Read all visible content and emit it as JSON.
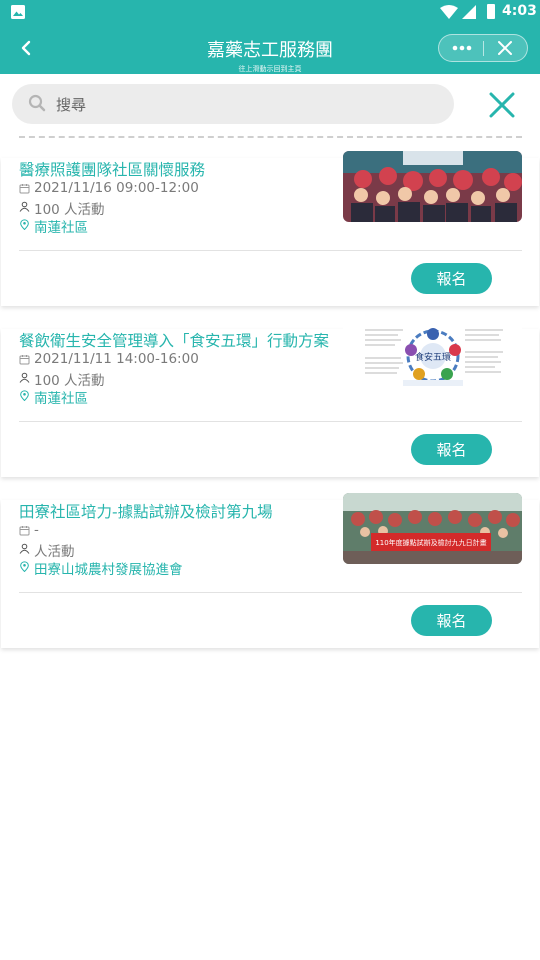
{
  "status_bar": {
    "time": "4:03"
  },
  "header": {
    "title": "嘉藥志工服務團",
    "subtitle": "往上滑動示回到主頁"
  },
  "search": {
    "placeholder": "搜尋",
    "value": ""
  },
  "cards": [
    {
      "title": "醫療照護團隊社區關懷服務",
      "date": "2021/11/16 09:00-12:00",
      "people": "100 人活動",
      "location": "南蓮社區",
      "button": "報名"
    },
    {
      "title": "餐飲衛生安全管理導入「食安五環」行動方案",
      "date": "2021/11/11 14:00-16:00",
      "people": "100 人活動",
      "location": "南蓮社區",
      "button": "報名",
      "image_text": "食安五環"
    },
    {
      "title": "田寮社區培力-據點試辦及檢討第九場",
      "date": "-",
      "people": "人活動",
      "location": "田寮山城農村發展協進會",
      "button": "報名",
      "image_text": "110年度據點試辦及檢討九九日計畫"
    }
  ],
  "colors": {
    "accent": "#27b5ad"
  }
}
